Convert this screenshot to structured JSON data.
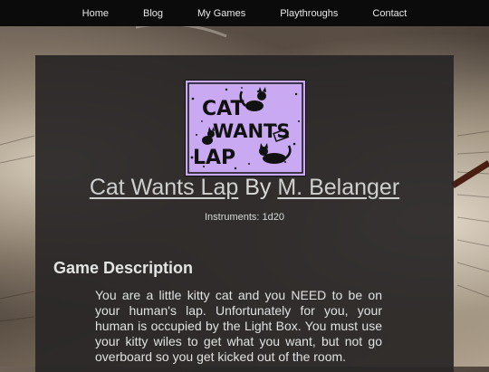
{
  "nav": {
    "items": [
      {
        "label": "Home"
      },
      {
        "label": "Blog"
      },
      {
        "label": "My Games"
      },
      {
        "label": "Playthroughs"
      },
      {
        "label": "Contact"
      }
    ]
  },
  "game": {
    "cover_text": [
      "CAT",
      "WANTS",
      "LAP"
    ],
    "title": "Cat Wants Lap",
    "by": "By",
    "author": "M. Belanger",
    "instruments": "Instruments: 1d20",
    "description_heading": "Game Description",
    "description": "You are a little kitty cat and you NEED to be on your human's lap. Unfortunately for you, your human is occupied by the Light Box. You must use your kitty wiles to get what you want, but not go overboard so you get kicked out of the room."
  },
  "colors": {
    "cover_bg": "#c9a9f2",
    "panel_bg": "#282626",
    "nav_bg": "#0b0b0b"
  }
}
